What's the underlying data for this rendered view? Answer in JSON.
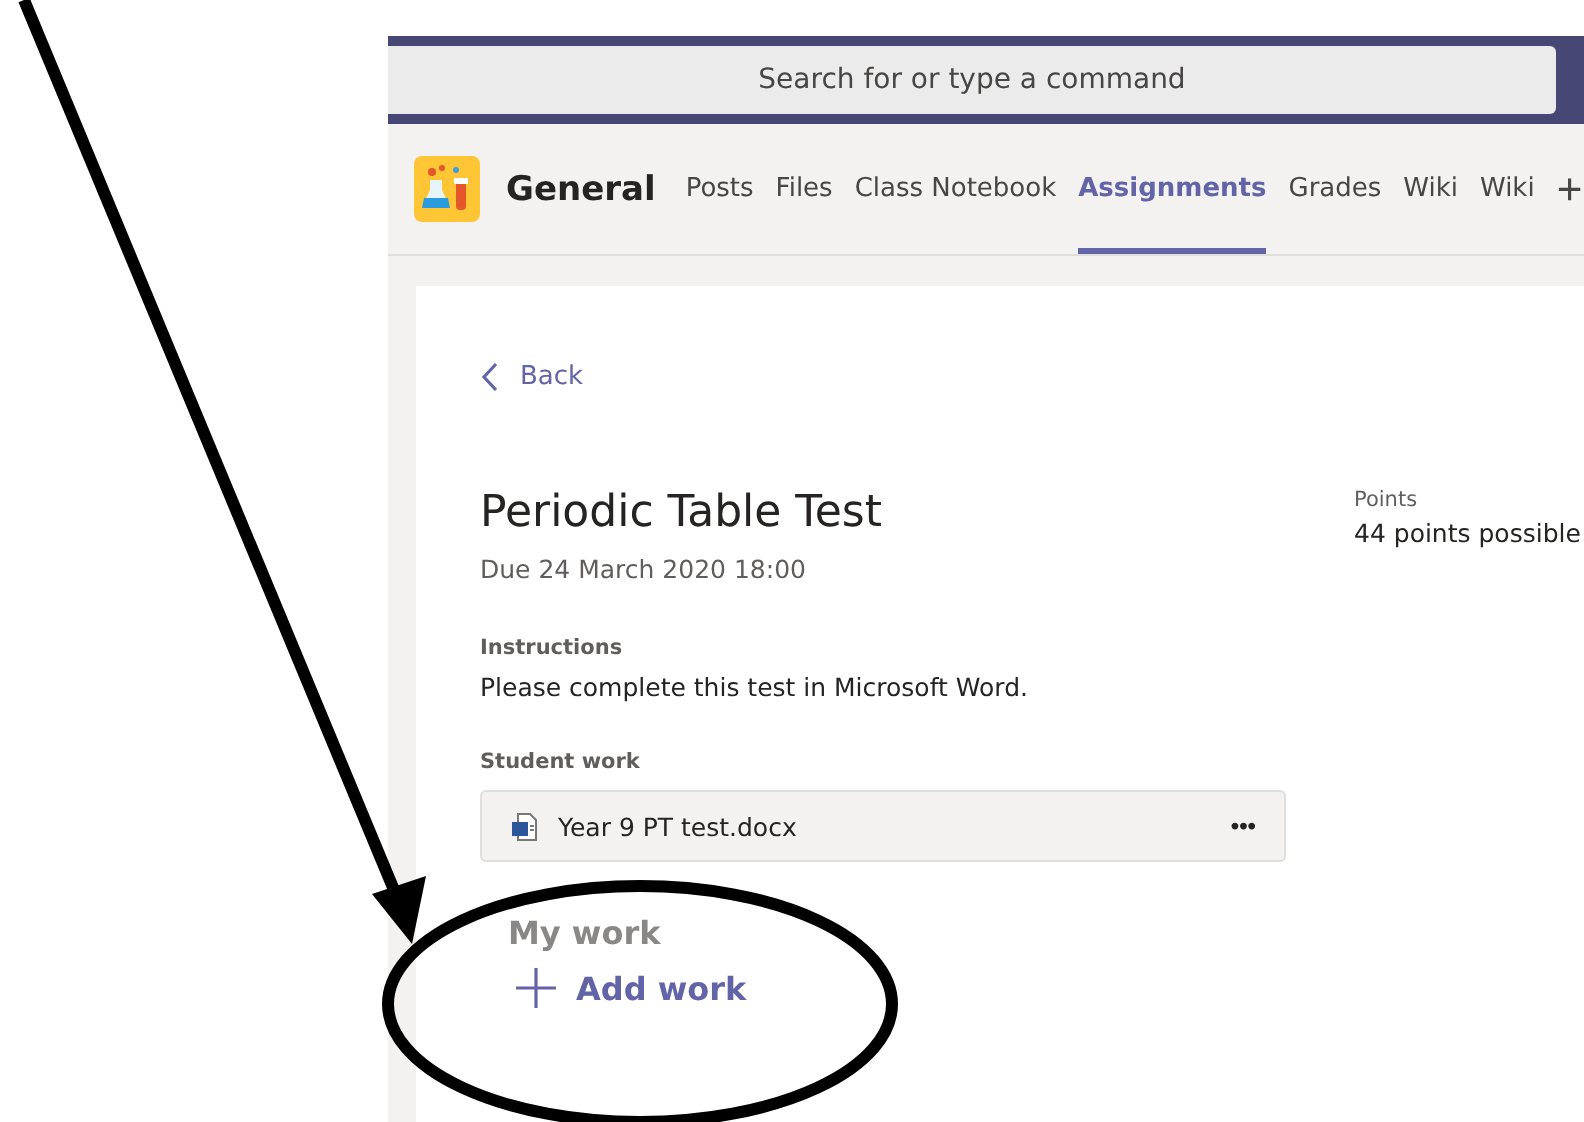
{
  "search": {
    "placeholder": "Search for or type a command"
  },
  "channel": {
    "name": "General"
  },
  "tabs": [
    {
      "label": "Posts",
      "selected": false
    },
    {
      "label": "Files",
      "selected": false
    },
    {
      "label": "Class Notebook",
      "selected": false
    },
    {
      "label": "Assignments",
      "selected": true
    },
    {
      "label": "Grades",
      "selected": false
    },
    {
      "label": "Wiki",
      "selected": false
    },
    {
      "label": "Wiki",
      "selected": false
    }
  ],
  "add_tab": "+",
  "back": "Back",
  "assignment": {
    "title": "Periodic Table Test",
    "due": "Due 24 March 2020 18:00",
    "points_label": "Points",
    "points": "44 points possible",
    "instructions_label": "Instructions",
    "instructions": "Please complete this test in Microsoft Word.",
    "student_work_label": "Student work"
  },
  "files": [
    {
      "name": "Year 9 PT test.docx",
      "more": "•••"
    }
  ],
  "my_work": {
    "heading": "My work",
    "add": "Add work"
  }
}
